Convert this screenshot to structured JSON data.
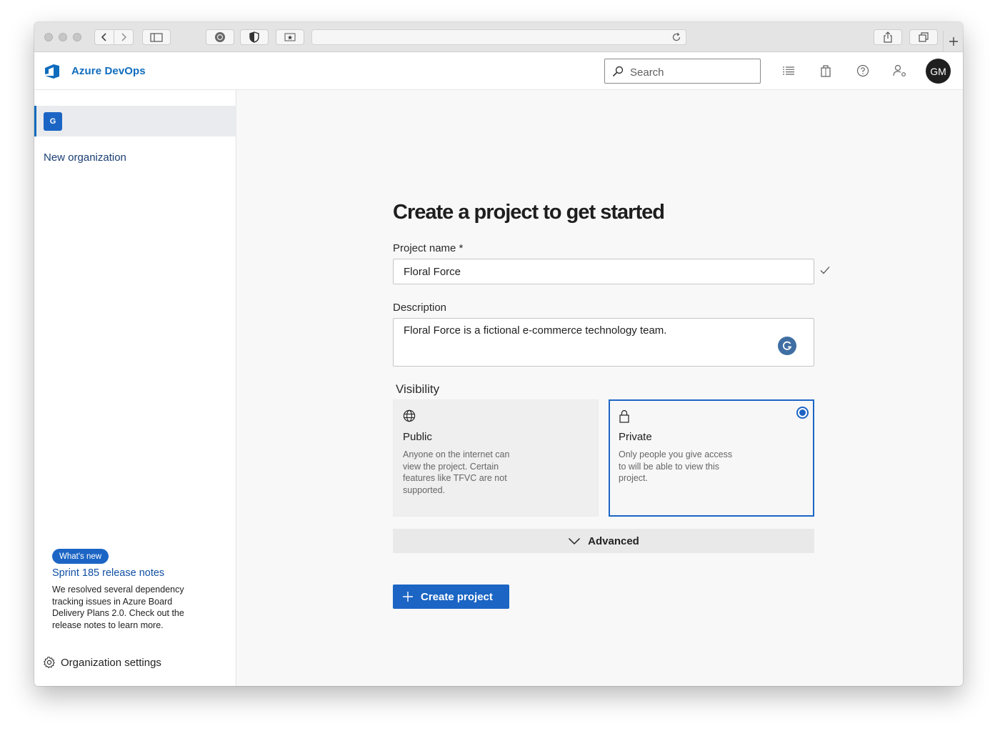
{
  "header": {
    "brand": "Azure DevOps",
    "search_placeholder": "Search",
    "avatar_initials": "GM",
    "accent_color": "#0f6cbd"
  },
  "sidebar": {
    "org_badge": "G",
    "new_org_label": "New organization",
    "whats_new": {
      "badge": "What's new",
      "title": "Sprint 185 release notes",
      "body": "We resolved several dependency tracking issues in Azure Board Delivery Plans 2.0. Check out the release notes to learn more."
    },
    "settings_label": "Organization settings"
  },
  "main": {
    "title": "Create a project to get started",
    "project_name_label": "Project name *",
    "project_name_value": "Floral Force",
    "description_label": "Description",
    "description_value": "Floral Force is a fictional e-commerce technology team.",
    "visibility_label": "Visibility",
    "visibility_options": [
      {
        "title": "Public",
        "description": "Anyone on the internet can view the project. Certain features like TFVC are not supported.",
        "selected": false,
        "icon": "globe-icon"
      },
      {
        "title": "Private",
        "description": "Only people you give access to will be able to view this project.",
        "selected": true,
        "icon": "lock-icon"
      }
    ],
    "advanced_label": "Advanced",
    "create_button_label": "Create project",
    "primary_color": "#1c65c4"
  }
}
